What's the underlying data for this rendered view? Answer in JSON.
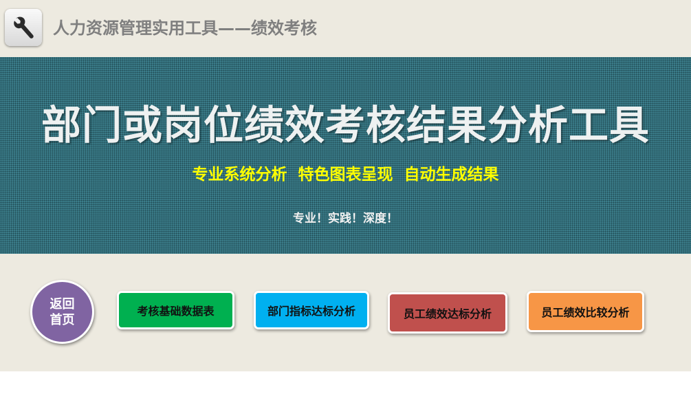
{
  "header": {
    "icon": "wrench-icon",
    "title": "人力资源管理实用工具——绩效考核"
  },
  "banner": {
    "title": "部门或岗位绩效考核结果分析工具",
    "subtitle": "专业系统分析  特色图表呈现  自动生成结果",
    "slogan": "专业！实践！深度！",
    "background_color": "#3c7f8c",
    "subtitle_color": "#ffff00"
  },
  "nav": {
    "home_line1": "返回",
    "home_line2": "首页",
    "buttons": [
      {
        "label": "考核基础数据表",
        "color": "#00b050"
      },
      {
        "label": "部门指标达标分析",
        "color": "#00b0f0"
      },
      {
        "label": "员工绩效达标分析",
        "color": "#c0504d"
      },
      {
        "label": "员工绩效比较分析",
        "color": "#f79646"
      }
    ],
    "home_color": "#8064a2"
  }
}
